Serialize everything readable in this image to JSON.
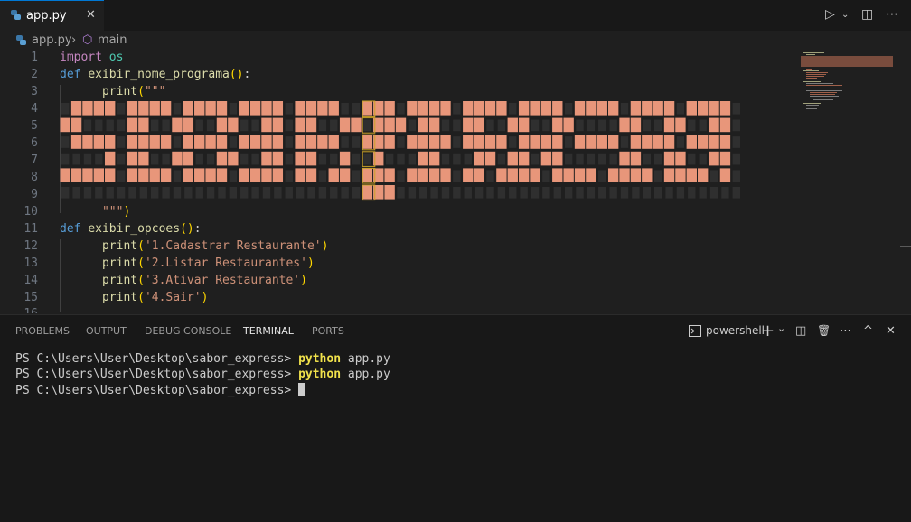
{
  "tab": {
    "filename": "app.py",
    "close": "✕"
  },
  "breadcrumb": {
    "file": "app.py",
    "separator": "›",
    "symbol": "main"
  },
  "toolbar": {
    "run": "▷",
    "split": "◫",
    "more": "⋯"
  },
  "editor": {
    "lines": [
      "1",
      "2",
      "3",
      "4",
      "5",
      "6",
      "7",
      "8",
      "9",
      "10",
      "11",
      "12",
      "13",
      "14",
      "15",
      "16"
    ],
    "code": {
      "l1_kw": "import",
      "l1_mod": "os",
      "l2_kw": "def",
      "l2_fn": "exibir_nome_programa",
      "l2_paren": "()",
      "l2_colon": ":",
      "l3_fn": "print",
      "l3_paren": "(",
      "l3_str": "\"\"\"",
      "l10_str": "\"\"\"",
      "l10_paren": ")",
      "l11_kw": "def",
      "l11_fn": "exibir_opcoes",
      "l11_paren": "()",
      "l11_colon": ":",
      "l12_fn": "print",
      "l12_str": "'1.Cadastrar Restaurante'",
      "l13_fn": "print",
      "l13_str": "'2.Listar Restaurantes'",
      "l14_fn": "print",
      "l14_str": "'3.Ativar Restaurante'",
      "l15_fn": "print",
      "l15_str": "'4.Sair'"
    }
  },
  "panel": {
    "tabs": [
      "PROBLEMS",
      "OUTPUT",
      "DEBUG CONSOLE",
      "TERMINAL",
      "PORTS"
    ],
    "active_tab": "TERMINAL",
    "shell": "powershell",
    "icons": {
      "add": "+",
      "chevron": "⌄",
      "split": "◫",
      "trash": "🗑",
      "more": "⋯",
      "up": "^",
      "close": "✕"
    }
  },
  "terminal": {
    "lines": [
      {
        "prompt": "PS C:\\Users\\User\\Desktop\\sabor_express> ",
        "cmd": "python",
        "args": " app.py"
      },
      {
        "prompt": "PS C:\\Users\\User\\Desktop\\sabor_express> ",
        "cmd": "python",
        "args": " app.py"
      },
      {
        "prompt": "PS C:\\Users\\User\\Desktop\\sabor_express> ",
        "cmd": "",
        "args": ""
      }
    ]
  },
  "colors": {
    "accent": "#0078d4",
    "ascii_fill": "#e8967a",
    "ascii_border": "#c9a227"
  }
}
